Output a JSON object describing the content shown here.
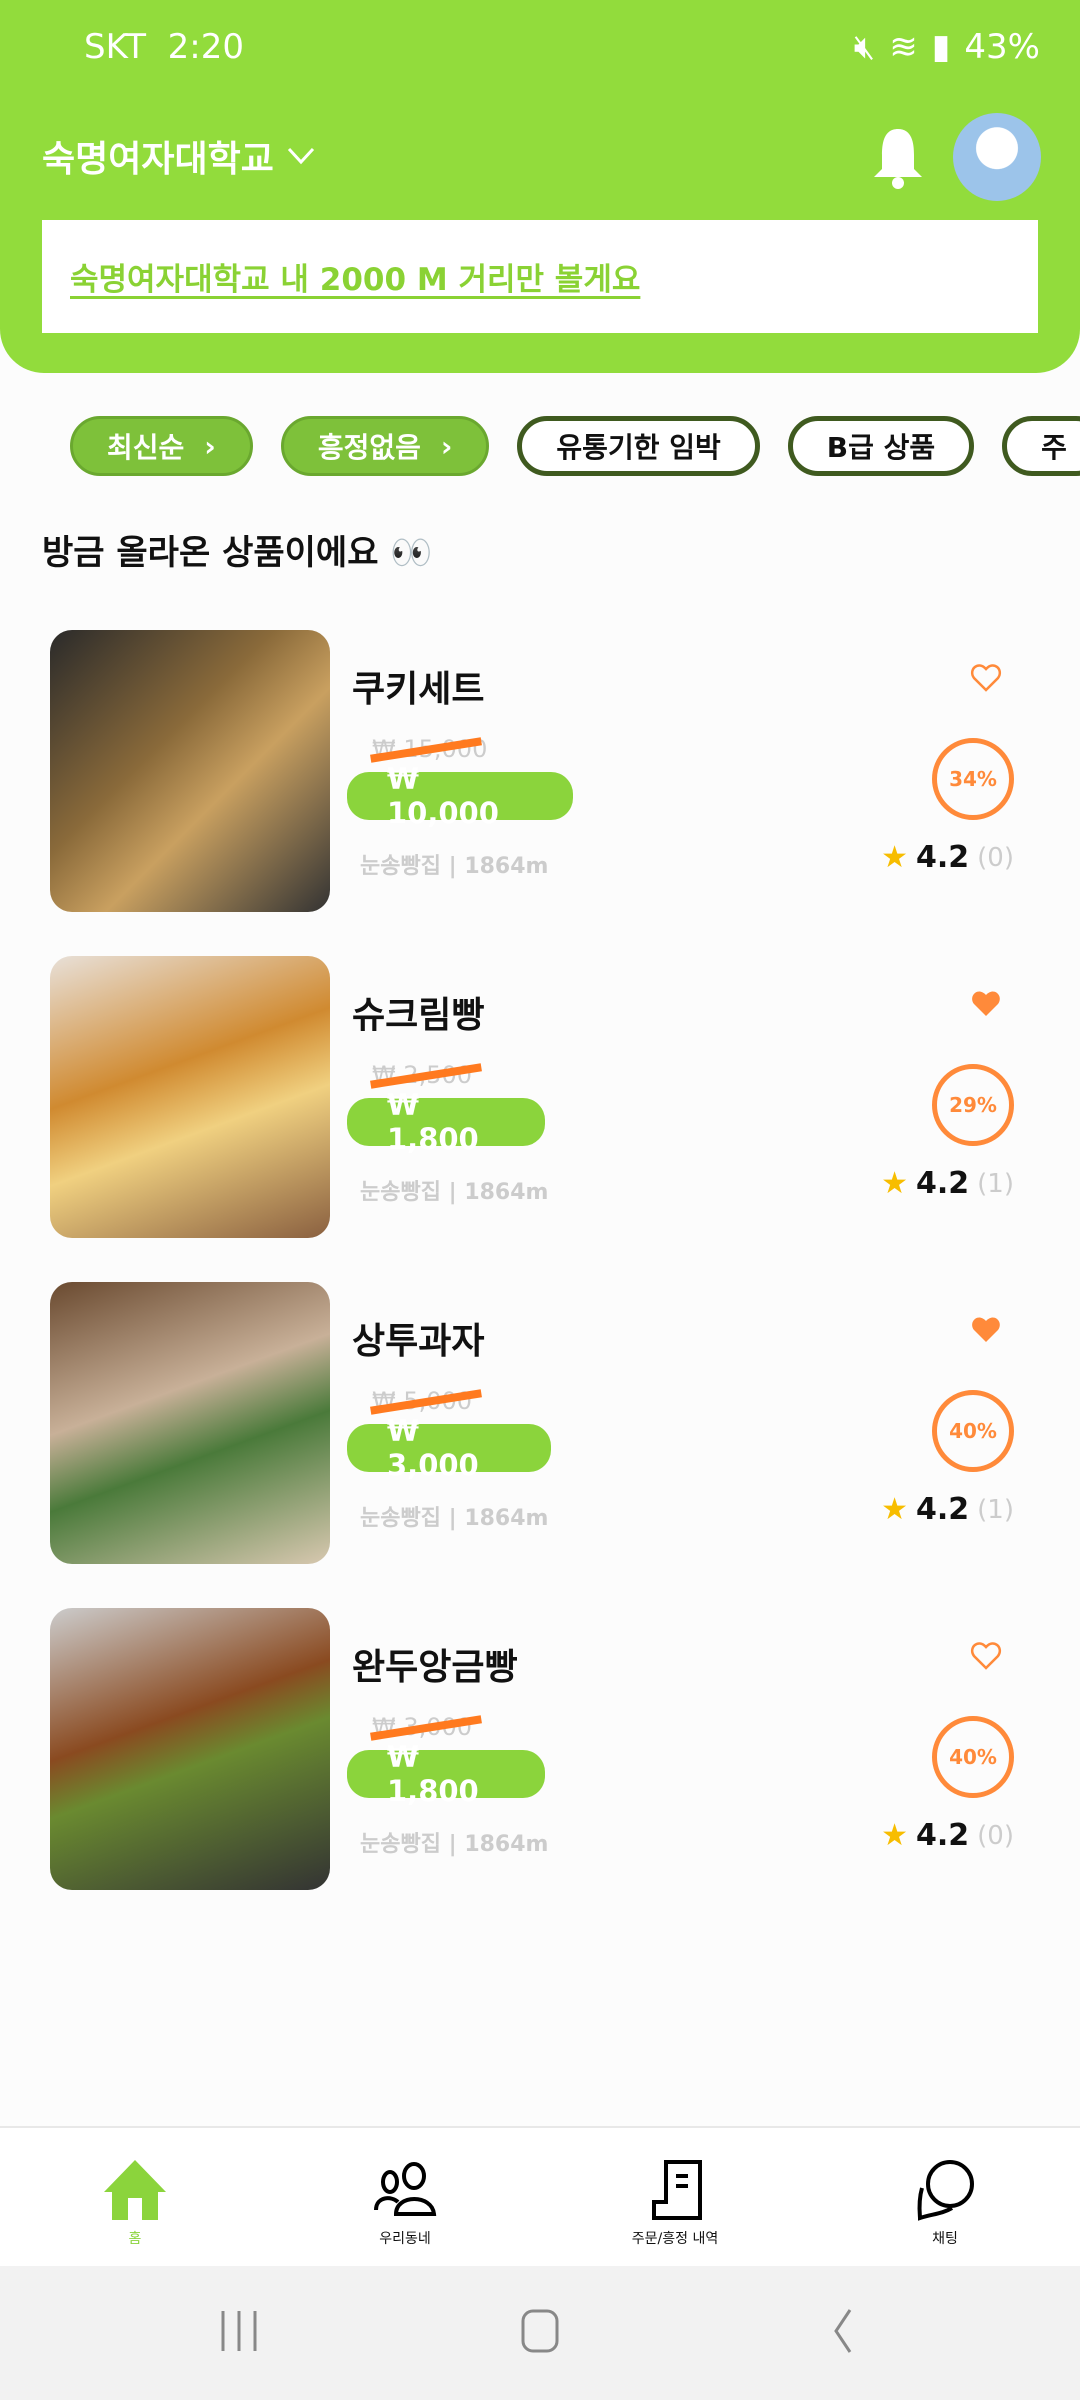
{
  "status_bar": {
    "carrier": "SKT",
    "time": "2:20",
    "battery": "43%"
  },
  "header": {
    "location": "숙명여자대학교",
    "banner": "숙명여자대학교 내 2000 M 거리만 볼게요"
  },
  "filters": [
    {
      "label": "최신순",
      "active": true
    },
    {
      "label": "흥정없음",
      "active": true
    },
    {
      "label": "유통기한 임박",
      "active": false
    },
    {
      "label": "B급 상품",
      "active": false
    },
    {
      "label": "주",
      "active": false
    }
  ],
  "section_title": "방금 올라온 상품이에요 👀",
  "products": [
    {
      "name": "쿠키세트",
      "original_price": "₩ 15,000",
      "price": "₩ 10,000",
      "store": "눈송빵집 | 1864m",
      "discount": "34%",
      "rating": "4.2",
      "reviews": "(0)",
      "liked": false
    },
    {
      "name": "슈크림빵",
      "original_price": "₩ 2,500",
      "price": "₩ 1,800",
      "store": "눈송빵집 | 1864m",
      "discount": "29%",
      "rating": "4.2",
      "reviews": "(1)",
      "liked": true
    },
    {
      "name": "상투과자",
      "original_price": "₩ 5,000",
      "price": "₩ 3,000",
      "store": "눈송빵집 | 1864m",
      "discount": "40%",
      "rating": "4.2",
      "reviews": "(1)",
      "liked": true
    },
    {
      "name": "완두앙금빵",
      "original_price": "₩ 3,000",
      "price": "₩ 1,800",
      "store": "눈송빵집 | 1864m",
      "discount": "40%",
      "rating": "4.2",
      "reviews": "(0)",
      "liked": false
    }
  ],
  "bottom_nav": [
    {
      "label": "홈",
      "icon": "home-icon",
      "active": true
    },
    {
      "label": "우리동네",
      "icon": "people-icon"
    },
    {
      "label": "주문/흥정 내역",
      "icon": "receipt-icon"
    },
    {
      "label": "채팅",
      "icon": "chat-icon"
    }
  ],
  "colors": {
    "brand": "#92dc3c",
    "accent": "#ff8a3a"
  }
}
